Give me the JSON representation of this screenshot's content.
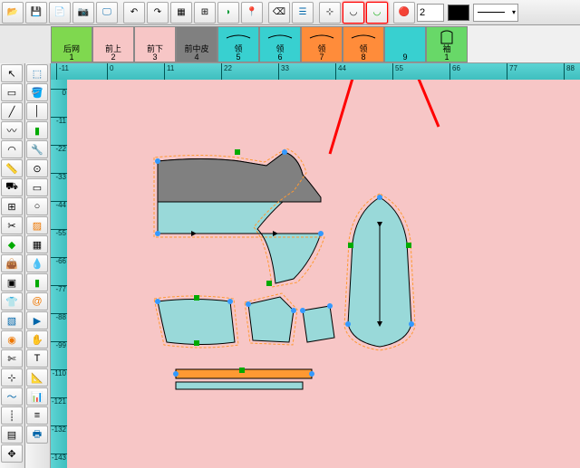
{
  "toolbar": {
    "value_input": "2",
    "fill_color": "#000000"
  },
  "pieces": [
    {
      "label": "后网",
      "num": "1",
      "bg": "#7fd84f"
    },
    {
      "label": "前上",
      "num": "2",
      "bg": "#f7c6c6"
    },
    {
      "label": "前下",
      "num": "3",
      "bg": "#f7c6c6"
    },
    {
      "label": "前中皮",
      "num": "4",
      "bg": "#808080"
    },
    {
      "label": "领",
      "num": "5",
      "bg": "#38d0d0"
    },
    {
      "label": "领",
      "num": "6",
      "bg": "#38d0d0"
    },
    {
      "label": "领",
      "num": "7",
      "bg": "#ff8c3a"
    },
    {
      "label": "领",
      "num": "8",
      "bg": "#ff8c3a"
    },
    {
      "label": "",
      "num": "9",
      "bg": "#38d0d0"
    },
    {
      "label": "袖",
      "num": "1",
      "bg": "#68d868"
    }
  ],
  "ruler_h": [
    "-11",
    "0",
    "11",
    "22",
    "33",
    "44",
    "55",
    "66",
    "77",
    "88"
  ],
  "ruler_v": [
    "0",
    "-11",
    "-22",
    "-33",
    "-44",
    "-55",
    "-66",
    "-77",
    "-88",
    "-99",
    "-110",
    "-121",
    "-132",
    "-143"
  ]
}
